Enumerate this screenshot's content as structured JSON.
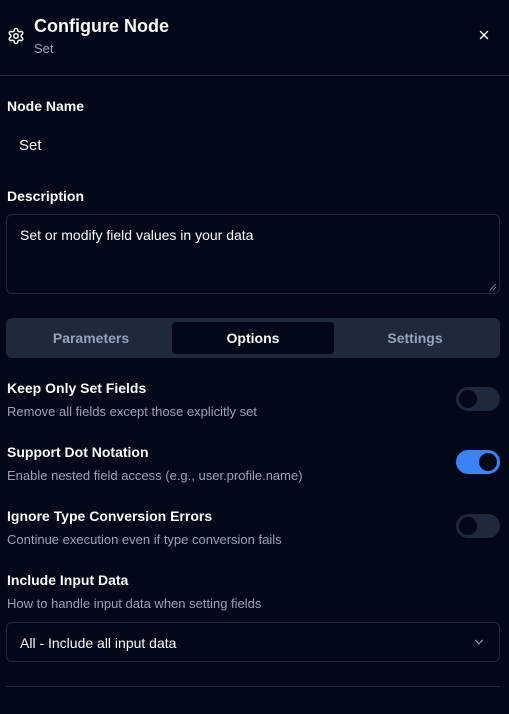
{
  "header": {
    "title": "Configure Node",
    "subtitle": "Set",
    "icon": "gear-icon",
    "close_icon": "close-icon"
  },
  "node_name": {
    "label": "Node Name",
    "value": "Set"
  },
  "description": {
    "label": "Description",
    "value": "Set or modify field values in your data"
  },
  "tabs": [
    {
      "label": "Parameters",
      "active": false
    },
    {
      "label": "Options",
      "active": true
    },
    {
      "label": "Settings",
      "active": false
    }
  ],
  "options": [
    {
      "title": "Keep Only Set Fields",
      "description": "Remove all fields except those explicitly set",
      "enabled": false
    },
    {
      "title": "Support Dot Notation",
      "description": "Enable nested field access (e.g., user.profile.name)",
      "enabled": true
    },
    {
      "title": "Ignore Type Conversion Errors",
      "description": "Continue execution even if type conversion fails",
      "enabled": false
    }
  ],
  "include_input": {
    "title": "Include Input Data",
    "description": "How to handle input data when setting fields",
    "selected": "All - Include all input data"
  },
  "colors": {
    "background": "#020817",
    "border": "#1e293b",
    "muted_text": "#94a3b8",
    "accent": "#3b82f6"
  }
}
